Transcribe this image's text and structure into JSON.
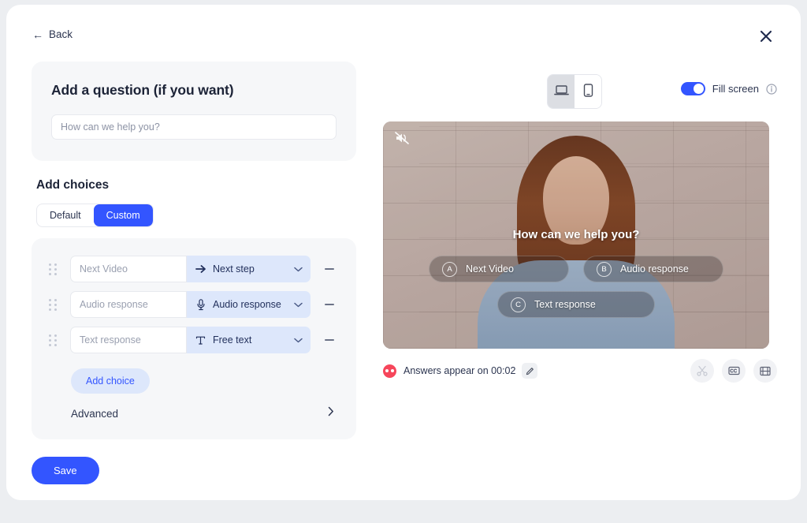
{
  "header": {
    "back_label": "Back",
    "back_icon": "arrow-left-icon",
    "close_icon": "close-icon"
  },
  "question_section": {
    "title": "Add a question (if you want)",
    "input_value": "",
    "input_placeholder": "How can we help you?"
  },
  "choices_section": {
    "title": "Add choices",
    "modes": [
      {
        "label": "Default",
        "selected": false
      },
      {
        "label": "Custom",
        "selected": true
      }
    ],
    "rows": [
      {
        "label_value": "",
        "label_placeholder": "Next Video",
        "action_label": "Next step",
        "action_icon": "arrow-right-icon"
      },
      {
        "label_value": "",
        "label_placeholder": "Audio response",
        "action_label": "Audio response",
        "action_icon": "microphone-icon"
      },
      {
        "label_value": "",
        "label_placeholder": "Text response",
        "action_label": "Free text",
        "action_icon": "text-type-icon"
      }
    ],
    "add_choice_label": "Add choice",
    "advanced_label": "Advanced",
    "advanced_icon": "chevron-right-icon",
    "remove_icon": "minus-icon",
    "drag_icon": "drag-handle-icon",
    "chevron_icon": "chevron-down-icon"
  },
  "save_button": {
    "label": "Save"
  },
  "preview": {
    "devices": [
      {
        "name": "desktop",
        "icon": "laptop-icon",
        "selected": true
      },
      {
        "name": "mobile",
        "icon": "phone-icon",
        "selected": false
      }
    ],
    "fill_screen": {
      "label": "Fill screen",
      "enabled": true,
      "info_icon": "info-icon"
    },
    "video": {
      "mute_icon": "speaker-muted-icon",
      "question_text": "How can we help you?",
      "answers": [
        {
          "badge": "A",
          "text": "Next Video"
        },
        {
          "badge": "B",
          "text": "Audio response"
        },
        {
          "badge": "C",
          "text": "Text response"
        }
      ]
    },
    "footer": {
      "answers_timing_label": "Answers appear on 00:02",
      "answers_icon": "answers-marker-icon",
      "edit_icon": "pencil-icon",
      "actions": [
        {
          "name": "trim",
          "icon": "scissors-icon"
        },
        {
          "name": "captions",
          "icon": "closed-caption-icon"
        },
        {
          "name": "filmstrip",
          "icon": "filmstrip-icon"
        }
      ]
    }
  },
  "colors": {
    "accent": "#3355ff",
    "accent_soft": "#dde7fb",
    "page_bg": "#eceef1",
    "card_bg": "#f6f7f9",
    "text_dark": "#1c2337",
    "answers_marker": "#f6465b"
  }
}
